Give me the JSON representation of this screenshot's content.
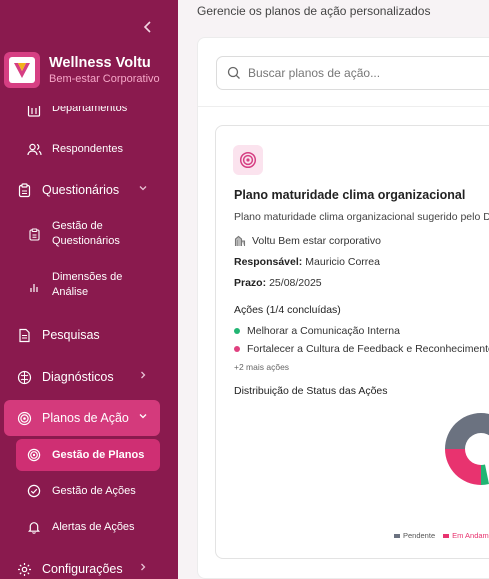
{
  "sidebar": {
    "brand": {
      "name": "Wellness Voltu",
      "subtitle": "Bem-estar Corporativo"
    },
    "items": [
      {
        "label": "Departamentos",
        "icon": "building-icon"
      },
      {
        "label": "Respondentes",
        "icon": "users-icon"
      },
      {
        "label": "Questionários",
        "icon": "clipboard-icon"
      },
      {
        "label": "Gestão de Questionários",
        "icon": "clipboard-list-icon"
      },
      {
        "label": "Dimensões de Análise",
        "icon": "bar-chart-icon"
      },
      {
        "label": "Pesquisas",
        "icon": "file-text-icon"
      },
      {
        "label": "Diagnósticos",
        "icon": "brain-icon"
      },
      {
        "label": "Planos de Ação",
        "icon": "target-icon"
      },
      {
        "label": "Gestão de Planos",
        "icon": "target-icon"
      },
      {
        "label": "Gestão de Ações",
        "icon": "check-circle-icon"
      },
      {
        "label": "Alertas de Ações",
        "icon": "bell-icon"
      },
      {
        "label": "Configurações",
        "icon": "gear-icon"
      }
    ]
  },
  "main": {
    "subtitle": "Gerencie os planos de ação personalizados",
    "search_placeholder": "Buscar planos de ação...",
    "card": {
      "title": "Plano maturidade clima organizacional",
      "description": "Plano maturidade clima organizacional sugerido pelo D",
      "company": "Voltu Bem estar corporativo",
      "responsible_label": "Responsável:",
      "responsible": "Mauricio Correa",
      "deadline_label": "Prazo:",
      "deadline": "25/08/2025",
      "actions_heading": "Ações (1/4 concluídas)",
      "actions": [
        {
          "label": "Melhorar a Comunicação Interna",
          "color": "#22b573"
        },
        {
          "label": "Fortalecer a Cultura de Feedback e Reconhecimento",
          "color": "#e0407f"
        }
      ],
      "more_actions": "+2 mais ações",
      "chart_heading": "Distribuição de Status das Ações",
      "legend": [
        {
          "label": "Pendente",
          "color": "#6b7280"
        },
        {
          "label": "Em Andam",
          "color": "#e8336f"
        }
      ]
    }
  },
  "colors": {
    "sidebar": "#8a1a4e",
    "accent": "#d43a7c",
    "brand_sub": "#f6a7c8"
  }
}
